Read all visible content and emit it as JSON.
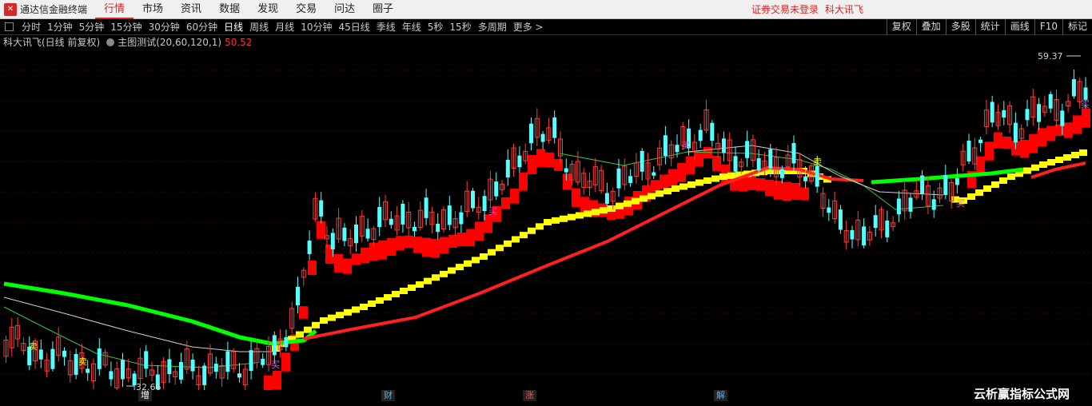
{
  "app": {
    "logo_icon": "tdx-logo-icon",
    "title": "通达信金融终端",
    "menu": [
      {
        "label": "行情",
        "active": true
      },
      {
        "label": "市场"
      },
      {
        "label": "资讯"
      },
      {
        "label": "数据"
      },
      {
        "label": "发现"
      },
      {
        "label": "交易"
      },
      {
        "label": "问达"
      },
      {
        "label": "圈子"
      }
    ],
    "login_status": "证券交易未登录",
    "user_stock": "科大讯飞"
  },
  "toolbar": {
    "periods": [
      "分时",
      "1分钟",
      "5分钟",
      "15分钟",
      "30分钟",
      "60分钟",
      "日线",
      "周线",
      "月线",
      "10分钟",
      "45日线",
      "季线",
      "年线",
      "5秒",
      "15秒",
      "多周期",
      "更多 >"
    ],
    "active_period": "日线",
    "right_buttons": [
      "复权",
      "叠加",
      "多股",
      "统计",
      "画线",
      "F10",
      "标记"
    ]
  },
  "info": {
    "stock_title": "科大讯飞(日线 前复权)",
    "indicator_name": "主图测试(20,60,120,1)",
    "indicator_value": "50.52"
  },
  "chart_labels": {
    "high_price": "59.37",
    "low_price": "32.66",
    "signals": [
      {
        "text": "卖",
        "color": "#ffff00"
      },
      {
        "text": "卖",
        "color": "#ffff00"
      },
      {
        "text": "买",
        "color": "#ff40ff"
      },
      {
        "text": "买",
        "color": "#ff40ff"
      },
      {
        "text": "买",
        "color": "#ff40ff"
      },
      {
        "text": "卖",
        "color": "#ffff00"
      },
      {
        "text": "买",
        "color": "#ff40ff"
      },
      {
        "text": "买",
        "color": "#ff40ff"
      }
    ],
    "bottom_tags": [
      {
        "text": "增",
        "color": "#ffffff"
      },
      {
        "text": "财",
        "color": "#6fa8dc"
      },
      {
        "text": "涨",
        "color": "#ff5050"
      },
      {
        "text": "解",
        "color": "#6fa8dc"
      }
    ]
  },
  "colors": {
    "up": "#ff3c3c",
    "down": "#54ffff",
    "background": "#000000",
    "ma_green": "#00ff00",
    "ma_yellow": "#ffff00",
    "ma_red": "#ff2020",
    "step_red": "#ff0000",
    "step_yellow": "#ffff00"
  },
  "watermark": "云析赢指标公式网"
}
